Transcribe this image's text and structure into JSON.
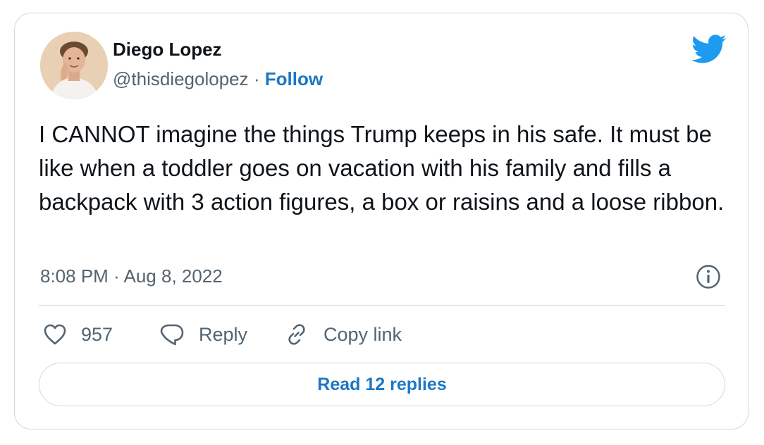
{
  "tweet": {
    "author": {
      "name": "Diego Lopez",
      "handle": "@thisdiegolopez",
      "separator": "·",
      "follow_label": "Follow",
      "avatar": "profile-photo"
    },
    "text": "I CANNOT imagine the things Trump keeps in his safe. It must be like when a toddler goes on vacation with his family and fills a backpack with 3 action figures, a box or raisins and a loose ribbon.",
    "timestamp": "8:08 PM · Aug 8, 2022",
    "actions": {
      "like_count": "957",
      "reply_label": "Reply",
      "copy_link_label": "Copy link"
    },
    "read_replies_label": "Read 12 replies"
  },
  "icons": {
    "brand": "twitter-bird-icon",
    "info": "info-icon",
    "like": "heart-icon",
    "reply": "speech-bubble-icon",
    "copy_link": "link-icon"
  },
  "colors": {
    "brand_blue": "#1d9bf0",
    "link_blue": "#1d76c4",
    "text_primary": "#0f1419",
    "text_secondary": "#536471",
    "border": "#cfd9de"
  }
}
